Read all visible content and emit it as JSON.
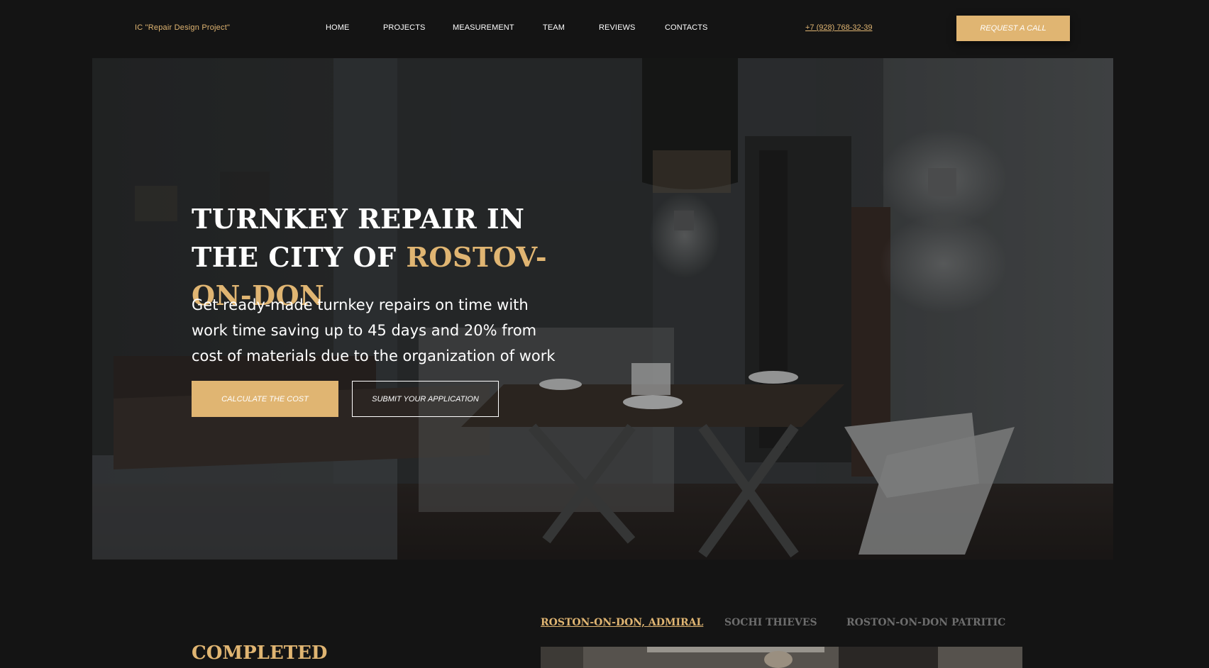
{
  "header": {
    "logo": "IC \"Repair Design Project\"",
    "nav": [
      "HOME",
      "PROJECTS",
      "MEASUREMENT",
      "TEAM",
      "REVIEWS",
      "CONTACTS"
    ],
    "phone": "+7 (928) 768-32-39",
    "cta": "REQUEST A CALL"
  },
  "hero": {
    "title_part1": "TURNKEY REPAIR IN THE CITY OF",
    "title_accent": "ROSTOV-ON-DON",
    "subtitle": "Get ready-made turnkey repairs on time with work time saving up to 45 days and 20% from cost of materials due to the organization of work",
    "btn_primary": "CALCULATE THE COST",
    "btn_secondary": "SUBMIT YOUR APPLICATION"
  },
  "projects": {
    "heading": "COMPLETED",
    "tabs": [
      "ROSTON-ON-DON, ADMIRAL",
      "SOCHI THIEVES",
      "ROSTON-ON-DON PATRITIC"
    ],
    "active_tab_index": 0
  },
  "colors": {
    "accent": "#e0b572",
    "background": "#141414",
    "text": "#ffffff"
  }
}
